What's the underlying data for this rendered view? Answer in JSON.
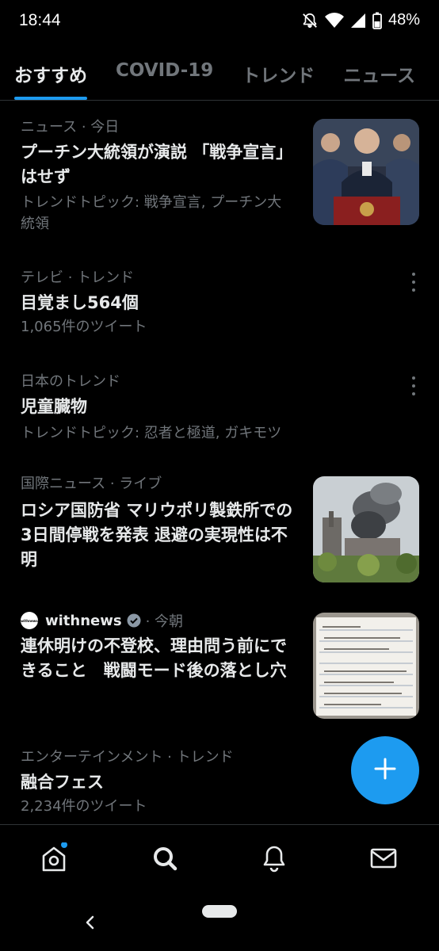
{
  "status": {
    "time": "18:44",
    "battery": "48%"
  },
  "tabs": [
    {
      "label": "おすすめ",
      "active": true
    },
    {
      "label": "COVID-19",
      "active": false
    },
    {
      "label": "トレンド",
      "active": false
    },
    {
      "label": "ニュース",
      "active": false
    }
  ],
  "feed": [
    {
      "meta": "ニュース · 今日",
      "title": "プーチン大統領が演説 「戦争宣言」はせず",
      "sub": "トレンドトピック: 戦争宣言, プーチン大統領"
    },
    {
      "meta": "テレビ · トレンド",
      "title": "目覚まし564個",
      "sub": "1,065件のツイート"
    },
    {
      "meta": "日本のトレンド",
      "title": "児童臓物",
      "sub": "トレンドトピック: 忍者と極道, ガキモツ"
    },
    {
      "meta": "国際ニュース · ライブ",
      "title": "ロシア国防省 マリウポリ製鉄所での3日間停戦を発表 退避の実現性は不明"
    },
    {
      "source": "withnews",
      "time": "· 今朝",
      "logo_text": "withnews",
      "title": "連休明けの不登校、理由問う前にできること　戦闘モード後の落とし穴"
    },
    {
      "meta": "エンターテインメント · トレンド",
      "title": "融合フェス",
      "sub": "2,234件のツイート"
    }
  ],
  "fab_icon": "plus-icon",
  "nav": [
    "home-icon",
    "search-icon",
    "bell-icon",
    "mail-icon"
  ],
  "colors": {
    "accent": "#1d9bf0",
    "background": "#000000",
    "secondary_text": "#71767b"
  }
}
